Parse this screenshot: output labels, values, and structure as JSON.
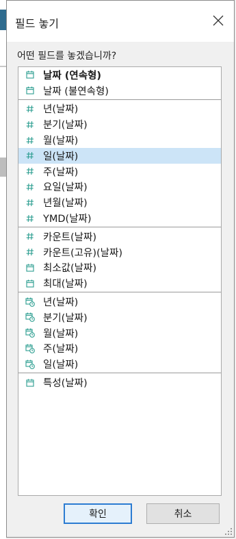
{
  "dialog": {
    "title": "필드 놓기",
    "prompt": "어떤 필드를 놓겠습니까?",
    "ok_label": "확인",
    "cancel_label": "취소"
  },
  "groups": [
    {
      "items": [
        {
          "label": "날짜 (연속형)",
          "icon": "calendar-icon",
          "bold": true
        },
        {
          "label": "날짜 (불연속형)",
          "icon": "calendar-icon"
        }
      ]
    },
    {
      "items": [
        {
          "label": "년(날짜)",
          "icon": "hash-icon"
        },
        {
          "label": "분기(날짜)",
          "icon": "hash-icon"
        },
        {
          "label": "월(날짜)",
          "icon": "hash-icon"
        },
        {
          "label": "일(날짜)",
          "icon": "hash-icon",
          "selected": true
        },
        {
          "label": "주(날짜)",
          "icon": "hash-icon"
        },
        {
          "label": "요일(날짜)",
          "icon": "hash-icon"
        },
        {
          "label": "년월(날짜)",
          "icon": "hash-icon"
        },
        {
          "label": "YMD(날짜)",
          "icon": "hash-icon"
        }
      ]
    },
    {
      "items": [
        {
          "label": "카운트(날짜)",
          "icon": "hash-icon"
        },
        {
          "label": "카운트(고유)(날짜)",
          "icon": "hash-icon"
        },
        {
          "label": "최소값(날짜)",
          "icon": "calendar-icon"
        },
        {
          "label": "최대(날짜)",
          "icon": "calendar-icon"
        }
      ]
    },
    {
      "items": [
        {
          "label": "년(날짜)",
          "icon": "calendar-clock-icon"
        },
        {
          "label": "분기(날짜)",
          "icon": "calendar-clock-icon"
        },
        {
          "label": "월(날짜)",
          "icon": "calendar-clock-icon"
        },
        {
          "label": "주(날짜)",
          "icon": "calendar-clock-icon"
        },
        {
          "label": "일(날짜)",
          "icon": "calendar-clock-icon"
        }
      ]
    },
    {
      "items": [
        {
          "label": "특성(날짜)",
          "icon": "calendar-icon"
        }
      ]
    }
  ],
  "colors": {
    "accent": "#2b7bd1",
    "selection": "#cce4f7",
    "icon": "#2a9d8f"
  }
}
